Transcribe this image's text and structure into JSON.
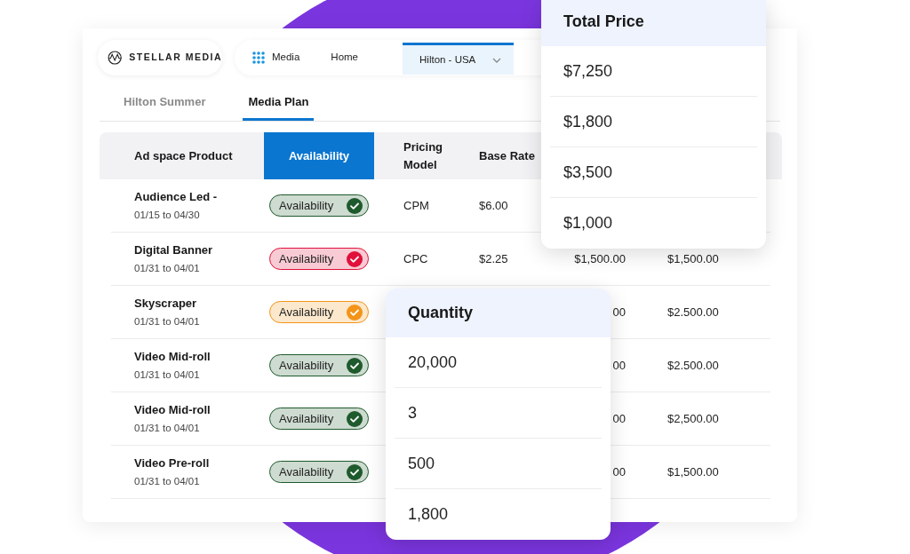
{
  "header": {
    "logo": "STELLAR MEDIA",
    "nav": [
      {
        "label": "Media",
        "kind": "app",
        "selected": false
      },
      {
        "label": "Home",
        "kind": "link",
        "selected": false
      },
      {
        "label": "Hilton - USA",
        "kind": "tab",
        "selected": true
      }
    ]
  },
  "tabs": [
    {
      "label": "Hilton Summer",
      "selected": false
    },
    {
      "label": "Media Plan",
      "selected": true
    }
  ],
  "table": {
    "columns": [
      {
        "label": "Ad space Product",
        "selected": false
      },
      {
        "label": "Availability",
        "selected": true
      },
      {
        "label": "Pricing Model",
        "selected": false
      },
      {
        "label": "Base Rate",
        "selected": false
      }
    ],
    "rows": [
      {
        "product": "Audience Led -",
        "dates": "01/15 to 04/30",
        "availability": {
          "label": "Availability",
          "color": "#1e5a2c"
        },
        "pricing_model": "CPM",
        "base_rate": "$6.00"
      },
      {
        "product": "Digital Banner",
        "dates": "01/31 to 04/01",
        "availability": {
          "label": "Availability",
          "color": "#e0103a"
        },
        "pricing_model": "CPC",
        "base_rate": "$2.25",
        "column_5": "$1,500.00",
        "column_6": "$1,500.00"
      },
      {
        "product": "Skyscraper",
        "dates": "01/31 to 04/01",
        "availability": {
          "label": "Availability",
          "color": "#f39419"
        },
        "column_5": "00",
        "column_6": "$2.500.00"
      },
      {
        "product": "Video Mid-roll",
        "dates": "01/31 to 04/01",
        "availability": {
          "label": "Availability",
          "color": "#1e5a2c"
        },
        "column_5": "00",
        "column_6": "$2.500.00"
      },
      {
        "product": "Video Mid-roll",
        "dates": "01/31 to 04/01",
        "availability": {
          "label": "Availability",
          "color": "#1e5a2c"
        },
        "column_5": "00",
        "column_6": "$2,500.00"
      },
      {
        "product": "Video Pre-roll",
        "dates": "01/31 to 04/01",
        "availability": {
          "label": "Availability",
          "color": "#1e5a2c"
        },
        "column_5": "00",
        "column_6": "$1,500.00"
      }
    ]
  },
  "total_price_card": {
    "title": "Total Price",
    "values": [
      "$7,250",
      "$1,800",
      "$3,500",
      "$1,000"
    ]
  },
  "quantity_card": {
    "title": "Quantity",
    "values": [
      "20,000",
      "3",
      "500",
      "1,800"
    ]
  }
}
